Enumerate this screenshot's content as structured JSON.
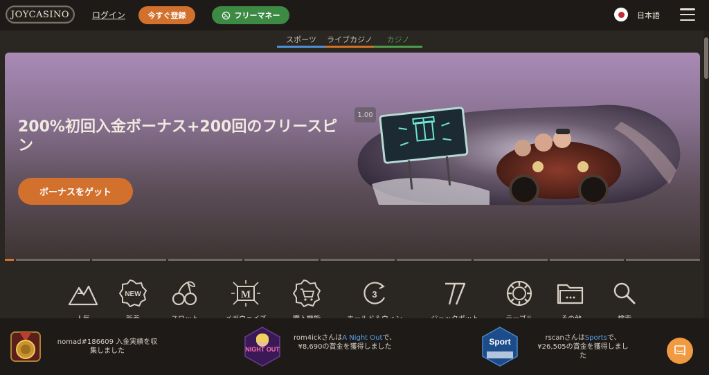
{
  "header": {
    "logo_text": "JOYCASINO",
    "login_label": "ログイン",
    "register_label": "今すぐ登録",
    "free_money_label": "フリーマネー",
    "language_label": "日本語"
  },
  "tabs": [
    {
      "label": "スポーツ",
      "color": "#4f8fd6",
      "active": false
    },
    {
      "label": "ライブカジノ",
      "color": "#d2702e",
      "active": false
    },
    {
      "label": "カジノ",
      "color": "#4f9a4d",
      "active": true
    }
  ],
  "banner": {
    "title": "200%初回入金ボーナス+200回のフリースピン",
    "cta_label": "ボーナスをゲット",
    "timer": "1.00"
  },
  "categories": [
    {
      "label": "人気",
      "icon": "mountain-icon"
    },
    {
      "label": "新着",
      "icon": "new-badge-icon"
    },
    {
      "label": "スロット",
      "icon": "cherries-icon"
    },
    {
      "label": "メガウェイズ",
      "icon": "megaways-icon"
    },
    {
      "label": "購入機能",
      "icon": "shopping-cart-icon"
    },
    {
      "label": "ホールド＆ウィン",
      "icon": "hold-and-win-icon"
    },
    {
      "label": "ジャックポット",
      "icon": "lucky-seven-icon"
    },
    {
      "label": "テーブル",
      "icon": "casino-chip-icon"
    },
    {
      "label": "その他",
      "icon": "folder-icon"
    },
    {
      "label": "検索",
      "icon": "search-icon"
    }
  ],
  "ticker": [
    {
      "text_before": "nomad#186609 入金実績を収集しました",
      "highlight": "",
      "text_after": ""
    },
    {
      "text_before": "rom4ickさんは",
      "highlight": "A Night Out",
      "text_after": "で、¥8,690の賞金を獲得しました"
    },
    {
      "text_before": "rscanさんは",
      "highlight": "Sports",
      "text_after": "で、¥26,505の賞金を獲得しました"
    }
  ],
  "game_thumbs": {
    "night_out": "NIGHT OUT",
    "sport": "Sport"
  },
  "colors": {
    "accent_orange": "#d2702e",
    "accent_green": "#3c8a44",
    "link_blue": "#5aa2e8",
    "background": "#2a2622"
  }
}
